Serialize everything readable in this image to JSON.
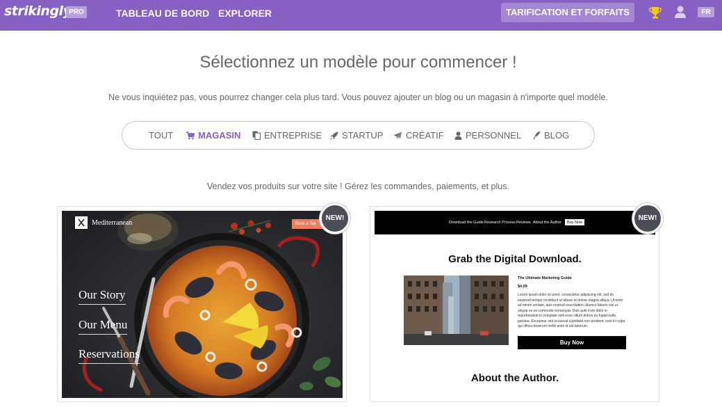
{
  "nav": {
    "logo": "strikingly",
    "pro_badge": "PRO",
    "dashboard": "TABLEAU DE BORD",
    "explore": "EXPLORER",
    "pricing": "TARIFICATION ET FORFAITS",
    "language": "FR",
    "icons": [
      "trophy-icon",
      "user-icon"
    ]
  },
  "main": {
    "title": "Sélectionnez un modèle pour commencer !",
    "subtitle": "Ne vous inquiétez pas, vous pourrez changer cela plus tard. Vous pouvez ajouter un blog ou un magasin à n'importe quel modèle.",
    "tagline": "Vendez vos produits sur votre site ! Gérez les commandes, paiements, et plus."
  },
  "filters": {
    "active": "MAGASIN",
    "active_color": "#8660c3",
    "items": [
      {
        "label": "TOUT",
        "icon": ""
      },
      {
        "label": "MAGASIN",
        "icon": "cart-icon"
      },
      {
        "label": "ENTREPRISE",
        "icon": "documents-icon"
      },
      {
        "label": "STARTUP",
        "icon": "rocket-icon"
      },
      {
        "label": "CRÉATIF",
        "icon": "paper-plane-icon"
      },
      {
        "label": "PERSONNEL",
        "icon": "person-icon"
      },
      {
        "label": "BLOG",
        "icon": "quill-icon"
      }
    ]
  },
  "templates": [
    {
      "badge": "NEW!",
      "brand": "Mediterranean",
      "book_button": "Book a Tab",
      "menu": [
        "Our Story",
        "Our Menu",
        "Reservations"
      ]
    },
    {
      "badge": "NEW!",
      "nav": [
        "Download the Guide",
        "Research Process",
        "Reviews",
        "About the Author"
      ],
      "nav_button": "Buy Now",
      "title": "Grab the Digital Download.",
      "product_name": "The Ultimate Marketing Guide",
      "price": "$4.99",
      "description": "Lorem ipsum dolor sit amet, consectetur adipiscing elit, sed do eiusmod tempor incididunt ut labore et dolore magna aliqua. Ut enim ad minim veniam, quis nostrud exercitation ullamco laboris nisi ut aliquip ex ea commodo consequat. Duis aute irure dolor in reprehenderit in voluptate velit esse cillum dolore eu fugiat nulla pariatur. Excepteur sint occaecat cupidatat non proident, sunt in culpa qui officia deserunt mollit anim id est laborum.",
      "buy_button": "Buy Now",
      "about_heading": "About the Author."
    }
  ]
}
